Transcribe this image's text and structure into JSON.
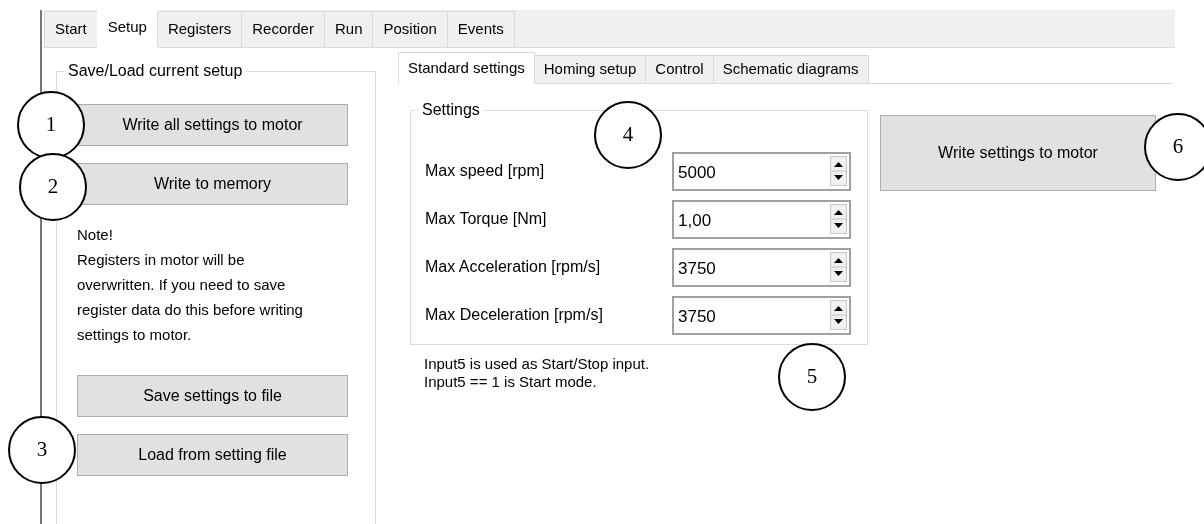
{
  "main_tabs": [
    {
      "label": "Start",
      "selected": false
    },
    {
      "label": "Setup",
      "selected": true
    },
    {
      "label": "Registers",
      "selected": false
    },
    {
      "label": "Recorder",
      "selected": false
    },
    {
      "label": "Run",
      "selected": false
    },
    {
      "label": "Position",
      "selected": false
    },
    {
      "label": "Events",
      "selected": false
    }
  ],
  "setup_group": {
    "title": "Save/Load current setup",
    "top_buttons": [
      "Write all settings to motor",
      "Write to memory"
    ],
    "note_title": "Note!",
    "note_text": "Registers in motor will be overwritten. If you need to save register data do this before writing settings to motor.",
    "file_buttons": [
      "Save settings to file",
      "Load from setting file"
    ]
  },
  "sub_tabs": [
    {
      "label": "Standard settings",
      "selected": true
    },
    {
      "label": "Homing setup",
      "selected": false
    },
    {
      "label": "Control",
      "selected": false
    },
    {
      "label": "Schematic diagrams",
      "selected": false
    }
  ],
  "settings_group": {
    "title": "Settings",
    "fields": [
      {
        "label": "Max speed [rpm]",
        "value": "5000"
      },
      {
        "label": "Max Torque [Nm]",
        "value": "1,00"
      },
      {
        "label": "Max Acceleration [rpm/s]",
        "value": "3750"
      },
      {
        "label": "Max Deceleration [rpm/s]",
        "value": "3750"
      }
    ]
  },
  "info_lines": [
    "Input5 is used as Start/Stop input.",
    "Input5 == 1 is Start mode."
  ],
  "write_button": "Write settings to motor",
  "callouts": [
    "1",
    "2",
    "3",
    "4",
    "5",
    "6"
  ]
}
